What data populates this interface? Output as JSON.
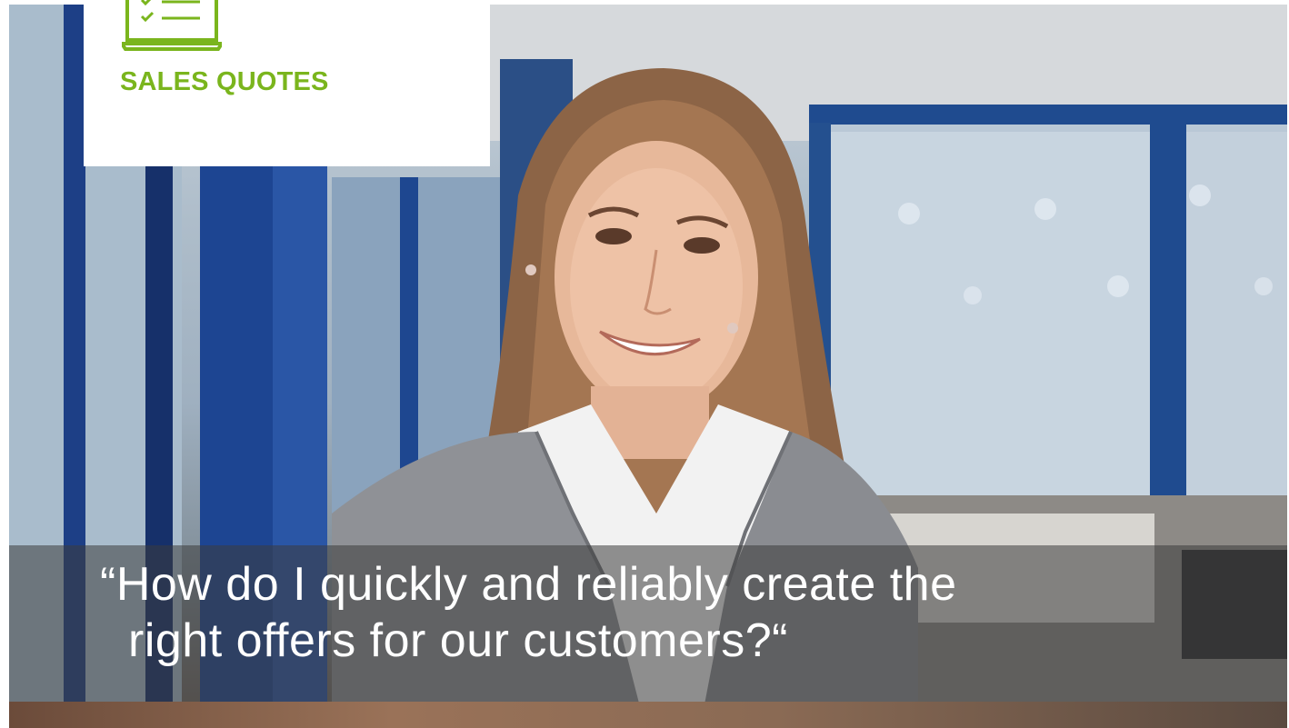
{
  "card": {
    "icon": "checklist-icon",
    "title": "SALES QUOTES"
  },
  "quote": {
    "line1": "“How do I quickly and reliably create the",
    "line2": "right offers for our customers?“"
  },
  "colors": {
    "accent_green": "#7ab51d",
    "quote_text": "#ffffff",
    "photo_blue": "#1d3f86"
  }
}
